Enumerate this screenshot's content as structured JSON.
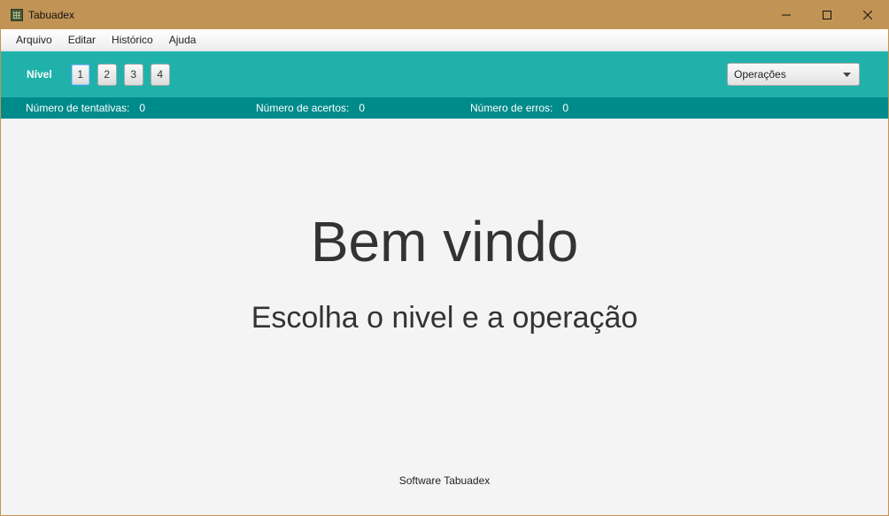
{
  "window": {
    "title": "Tabuadex",
    "controls": {
      "minimize": "minimize-icon",
      "maximize": "maximize-icon",
      "close": "close-icon"
    }
  },
  "menu": {
    "items": [
      {
        "label": "Arquivo"
      },
      {
        "label": "Editar"
      },
      {
        "label": "Histórico"
      },
      {
        "label": "Ajuda"
      }
    ]
  },
  "toolbar": {
    "nivel_label": "Nível",
    "levels": [
      {
        "label": "1",
        "selected": true
      },
      {
        "label": "2",
        "selected": false
      },
      {
        "label": "3",
        "selected": false
      },
      {
        "label": "4",
        "selected": false
      }
    ],
    "operations_select": {
      "value": "Operações"
    }
  },
  "stats": {
    "tentativas": {
      "label": "Número de tentativas:",
      "value": "0"
    },
    "acertos": {
      "label": "Número de acertos:",
      "value": "0"
    },
    "erros": {
      "label": "Número de erros:",
      "value": "0"
    }
  },
  "main": {
    "welcome": "Bem vindo",
    "instruction": "Escolha o nivel e a operação"
  },
  "footer": {
    "text": "Software Tabuadex"
  },
  "colors": {
    "titlebar": "#c19456",
    "toolbar": "#20b2aa",
    "statsbar": "#008b8b",
    "content_bg": "#f4f4f4"
  }
}
